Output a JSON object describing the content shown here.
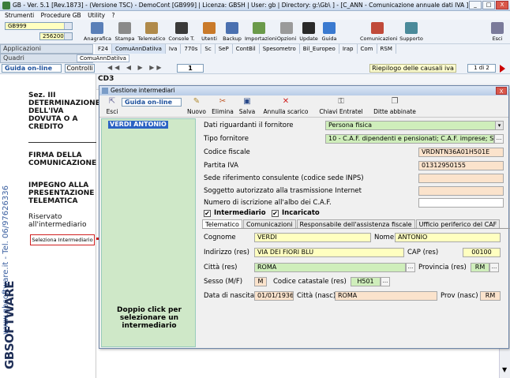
{
  "app": {
    "title": "GB - Ver. 5.1 [Rev.1873] - (Versione TSC) - DemoCont [GB999]  | Licenza: GBSH | User: gb | Directory: g:\\Gb\\ ] - [C_ANN - Comunicazione annuale dati IVA ]",
    "window_buttons": [
      "_",
      "□",
      "X"
    ]
  },
  "menubar": [
    "Strumenti",
    "Procedure GB",
    "Utility",
    "?"
  ],
  "toolbar": {
    "combo1": "GB999",
    "combo2": "256200 -",
    "buttons": [
      "Anagrafica",
      "Stampa",
      "Telematico",
      "Console T.",
      "Utenti",
      "Backup",
      "Importazioni",
      "Opzioni",
      "Update",
      "Guida",
      "Comunicazioni",
      "Supporto",
      "Esci"
    ]
  },
  "nav": {
    "applicazioni": "Applicazioni",
    "quadri": "Quadri",
    "tabs": [
      "F24",
      "ComuAnnDatiIva",
      "Iva",
      "770s",
      "Sc",
      "SeP",
      "ContBil",
      "Spesometro",
      "Bil_Europeo",
      "Irap",
      "Com",
      "RSM"
    ],
    "active_tab": "ComuAnnDatiIva",
    "subtab": "ComuAnnDatiIva"
  },
  "navrow": {
    "help": "Guida on-line",
    "controlli": "Controlli",
    "page": "1",
    "riepilogo": "Riepilogo delle causali iva",
    "page_of": "1 di 2"
  },
  "left": {
    "vertical_text": "www.gbsoftware.it - Tel. 06/97626336",
    "logo": "GBSOFTWARE",
    "sez3": "Sez. III DETERMINAZIONE DELL'IVA DOVUTA O A CREDITO",
    "firma": "FIRMA DELLA COMUNICAZIONE",
    "impegno": "IMPEGNO ALLA PRESENTAZIONE TELEMATICA",
    "riservato": "Riservato all'intermediario",
    "sel_button": "Seleziona Intermediario"
  },
  "bgform": {
    "cd3": "CD3"
  },
  "dialog": {
    "title": "Gestione intermediari",
    "toolbar": {
      "esci": "Esci",
      "help": "Guida on-line",
      "nuovo": "Nuovo",
      "elimina": "Elimina",
      "salva": "Salva",
      "annulla": "Annulla scarico",
      "chiavi": "Chiavi Entratel",
      "ditte": "Ditte abbinate"
    },
    "list_selected": "VERDI ANTONIO",
    "hint": "Doppio click per selezionare un intermediario",
    "labels": {
      "dati_fornitore": "Dati riguardanti il fornitore",
      "tipo_fornitore": "Tipo fornitore",
      "codice_fiscale": "Codice fiscale",
      "partita_iva": "Partita IVA",
      "sede_consulente": "Sede riferimento consulente (codice sede INPS)",
      "soggetto": "Soggetto autorizzato alla trasmissione Internet",
      "numero_iscrizione": "Numero di iscrizione all'albo dei C.A.F.",
      "intermediario": "Intermediario",
      "incaricato": "Incaricato",
      "cognome": "Cognome",
      "nome": "Nome",
      "indirizzo": "Indirizzo (res)",
      "cap": "CAP (res)",
      "citta": "Città (res)",
      "provincia": "Provincia (res)",
      "sesso": "Sesso (M/F)",
      "codice_catastale": "Codice catastale (res)",
      "data_nascita": "Data di nascita",
      "citta_nasc": "Città (nasc)",
      "prov_nasc": "Prov (nasc)"
    },
    "values": {
      "dati_fornitore": "Persona fisica",
      "tipo_fornitore": "10 - C.A.F. dipendenti e pensionati; C.A.F. imprese; S",
      "codice_fiscale": "VRDNTN36A01H501E",
      "partita_iva": "01312950155",
      "sede_consulente": "",
      "soggetto": "",
      "numero_iscrizione": "",
      "intermediario_checked": "✔",
      "incaricato_checked": "✔",
      "cognome": "VERDI",
      "nome": "ANTONIO",
      "indirizzo": "VIA DEI FIORI BLU",
      "cap": "00100",
      "citta": "ROMA",
      "provincia": "RM",
      "sesso": "M",
      "codice_catastale": "H501",
      "data_nascita": "01/01/1936",
      "citta_nasc": "ROMA",
      "prov_nasc": "RM"
    },
    "tabs": [
      "Telematico",
      "Comunicazioni",
      "Responsabile dell'assistenza fiscale",
      "Ufficio periferico del CAF"
    ],
    "active_tab": "Telematico"
  }
}
